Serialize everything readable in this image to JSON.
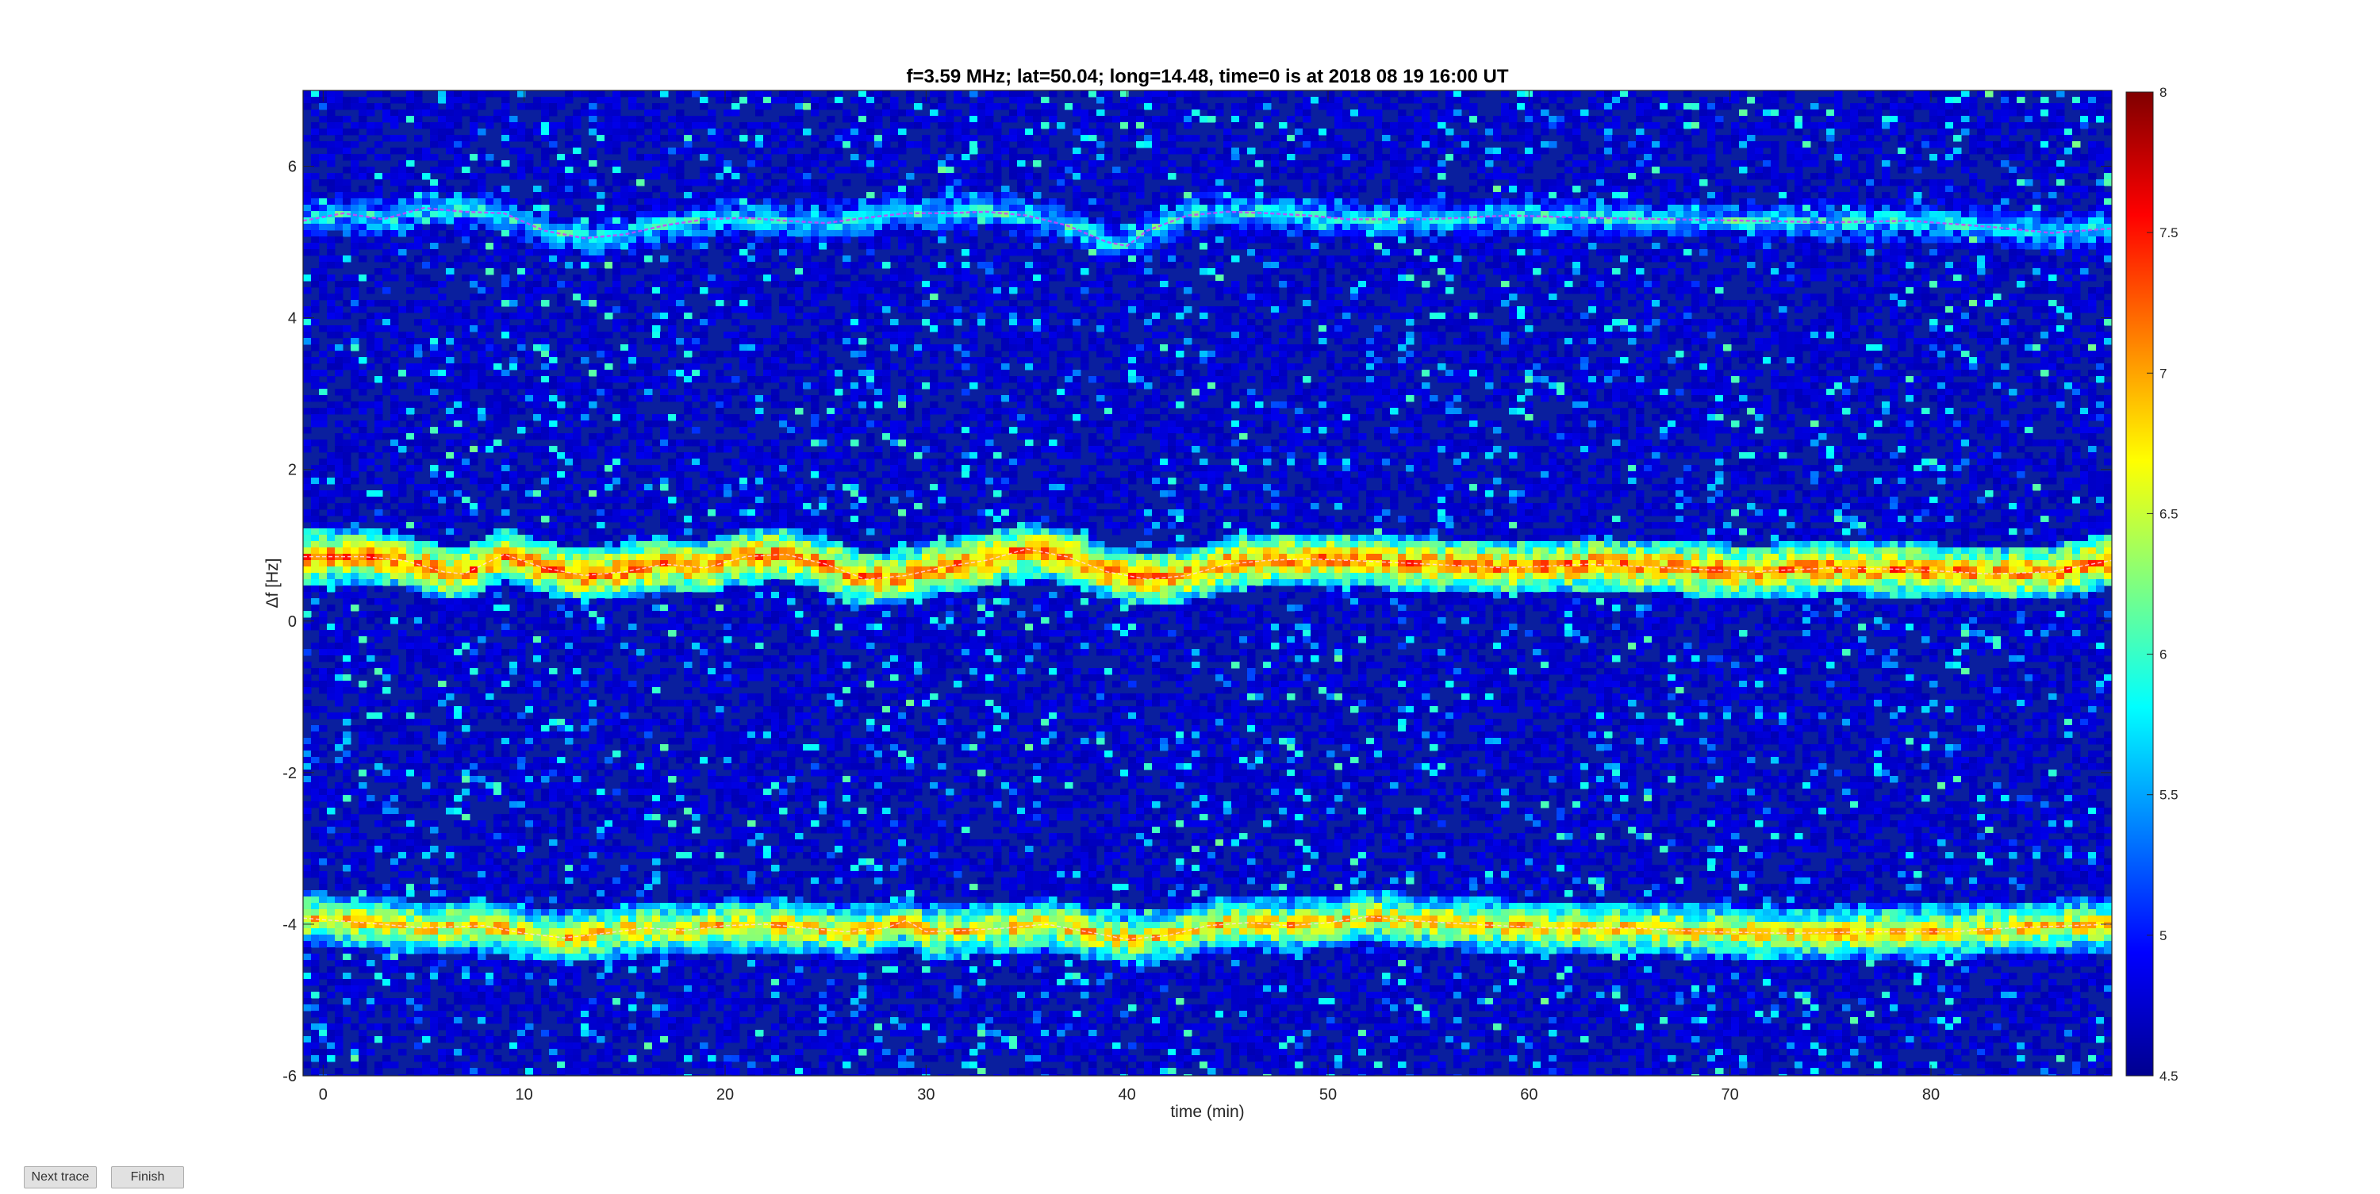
{
  "chart_data": {
    "type": "heatmap",
    "title": "f=3.59 MHz;  lat=50.04; long=14.48, time=0 is at 2018 08 19 16:00 UT",
    "xlabel": "time (min)",
    "ylabel": "Δf [Hz]",
    "xlim": [
      -1,
      89
    ],
    "ylim": [
      -6,
      7
    ],
    "x_ticks": [
      "0",
      "10",
      "20",
      "30",
      "40",
      "50",
      "60",
      "70",
      "80"
    ],
    "y_ticks": [
      "-6",
      "-4",
      "-2",
      "0",
      "2",
      "4",
      "6"
    ],
    "colormap": "jet",
    "colorbar": {
      "range": [
        4.5,
        8
      ],
      "ticks": [
        "4.5",
        "5",
        "5.5",
        "6",
        "6.5",
        "7",
        "7.5",
        "8"
      ]
    },
    "background_level": 4.7,
    "traces": [
      {
        "label": "",
        "points": [
          [
            -1,
            5.28
          ],
          [
            1,
            5.38
          ],
          [
            3,
            5.3
          ],
          [
            5,
            5.45
          ],
          [
            7,
            5.4
          ],
          [
            9,
            5.38
          ],
          [
            11,
            5.15
          ],
          [
            13,
            5.05
          ],
          [
            15,
            5.1
          ],
          [
            17,
            5.22
          ],
          [
            19,
            5.3
          ],
          [
            21,
            5.32
          ],
          [
            23,
            5.28
          ],
          [
            25,
            5.25
          ],
          [
            27,
            5.32
          ],
          [
            29,
            5.38
          ],
          [
            31,
            5.38
          ],
          [
            33,
            5.4
          ],
          [
            35,
            5.35
          ],
          [
            37,
            5.22
          ],
          [
            39,
            5.0
          ],
          [
            40,
            4.95
          ],
          [
            41,
            5.15
          ],
          [
            43,
            5.35
          ],
          [
            45,
            5.4
          ],
          [
            47,
            5.38
          ],
          [
            49,
            5.35
          ],
          [
            51,
            5.3
          ],
          [
            55,
            5.3
          ],
          [
            59,
            5.35
          ],
          [
            63,
            5.32
          ],
          [
            67,
            5.3
          ],
          [
            71,
            5.28
          ],
          [
            75,
            5.26
          ],
          [
            79,
            5.28
          ],
          [
            83,
            5.2
          ],
          [
            86,
            5.12
          ],
          [
            89,
            5.18
          ]
        ],
        "peak": 6.3
      },
      {
        "label": "",
        "points": [
          [
            -1,
            0.85
          ],
          [
            2,
            0.85
          ],
          [
            4,
            0.8
          ],
          [
            6,
            0.65
          ],
          [
            7,
            0.62
          ],
          [
            9,
            0.88
          ],
          [
            11,
            0.7
          ],
          [
            13,
            0.6
          ],
          [
            15,
            0.65
          ],
          [
            17,
            0.75
          ],
          [
            19,
            0.7
          ],
          [
            21,
            0.85
          ],
          [
            23,
            0.88
          ],
          [
            25,
            0.75
          ],
          [
            27,
            0.55
          ],
          [
            29,
            0.6
          ],
          [
            31,
            0.72
          ],
          [
            33,
            0.8
          ],
          [
            35,
            0.95
          ],
          [
            37,
            0.85
          ],
          [
            39,
            0.65
          ],
          [
            41,
            0.55
          ],
          [
            43,
            0.6
          ],
          [
            45,
            0.75
          ],
          [
            47,
            0.8
          ],
          [
            49,
            0.82
          ],
          [
            51,
            0.8
          ],
          [
            55,
            0.75
          ],
          [
            59,
            0.7
          ],
          [
            63,
            0.75
          ],
          [
            67,
            0.7
          ],
          [
            71,
            0.65
          ],
          [
            75,
            0.7
          ],
          [
            79,
            0.68
          ],
          [
            83,
            0.62
          ],
          [
            86,
            0.65
          ],
          [
            89,
            0.8
          ]
        ],
        "peak": 7.6
      },
      {
        "label": "",
        "points": [
          [
            -1,
            -3.92
          ],
          [
            2,
            -3.98
          ],
          [
            5,
            -4.05
          ],
          [
            8,
            -4.02
          ],
          [
            10,
            -4.12
          ],
          [
            12,
            -4.18
          ],
          [
            14,
            -4.12
          ],
          [
            16,
            -4.05
          ],
          [
            18,
            -4.08
          ],
          [
            20,
            -4.02
          ],
          [
            22,
            -4.0
          ],
          [
            24,
            -4.05
          ],
          [
            26,
            -4.1
          ],
          [
            28,
            -4.05
          ],
          [
            29,
            -3.95
          ],
          [
            30,
            -4.1
          ],
          [
            32,
            -4.08
          ],
          [
            34,
            -4.05
          ],
          [
            36,
            -4.0
          ],
          [
            38,
            -4.1
          ],
          [
            40,
            -4.2
          ],
          [
            42,
            -4.15
          ],
          [
            44,
            -4.02
          ],
          [
            46,
            -3.98
          ],
          [
            48,
            -4.02
          ],
          [
            50,
            -3.98
          ],
          [
            52,
            -3.9
          ],
          [
            54,
            -3.95
          ],
          [
            57,
            -4.0
          ],
          [
            61,
            -4.05
          ],
          [
            65,
            -4.05
          ],
          [
            69,
            -4.1
          ],
          [
            73,
            -4.12
          ],
          [
            77,
            -4.1
          ],
          [
            81,
            -4.1
          ],
          [
            84,
            -4.05
          ],
          [
            89,
            -4.0
          ]
        ],
        "peak": 7.3
      }
    ]
  },
  "buttons": {
    "next_trace": "Next trace",
    "finish": "Finish"
  }
}
